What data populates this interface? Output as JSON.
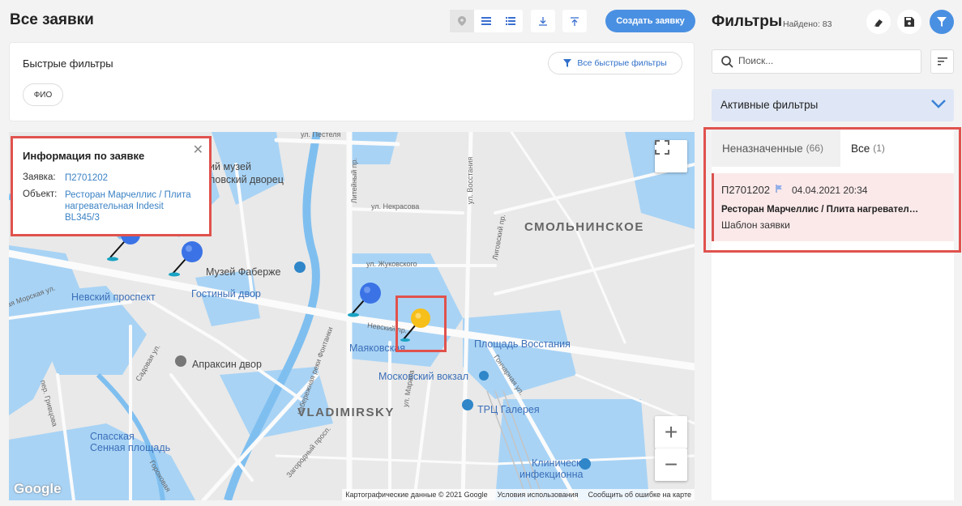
{
  "header": {
    "title": "Все заявки",
    "create_button": "Создать заявку"
  },
  "quick_filters": {
    "title": "Быстрые фильтры",
    "all_button": "Все быстрые фильтры",
    "chips": [
      "ФИО"
    ]
  },
  "map": {
    "info_window": {
      "title": "Информация по заявке",
      "request_label": "Заявка:",
      "request_value": "П2701202",
      "object_label": "Объект:",
      "object_value": "Ресторан Марчеллис / Плита нагревательная Indesit BL345/3"
    },
    "labels": {
      "museum_top": "ий музей",
      "palace": "ловский дворец",
      "faberge": "Музей Фаберже",
      "nevsky": "Невский проспект",
      "gostiny": "Гостиный двор",
      "nevsky_pr": "Невский пр.",
      "mayakovskaya": "Маяковская",
      "vosstaniya": "Площадь Восстания",
      "apraksin": "Апраксин двор",
      "moskovsky": "Московский вокзал",
      "smolninskoe": "СМОЛЬНИНСКОЕ",
      "vladimirsky": "VLADIMIRSKY",
      "galereya": "ТРЦ Галерея",
      "spasskaya": "Спасская",
      "sennaya": "Сенная площадь",
      "clinic1": "Клиническ",
      "clinic2": "инфекционна",
      "st_pestelya": "ул. Пестеля",
      "st_nekrasova": "ул. Некрасова",
      "st_zhukovskogo": "ул. Жуковского",
      "st_liteyny": "Литейный пр.",
      "st_voznesenskogo": "ул. Восстания",
      "st_ligovsky": "Лиговский пр.",
      "st_goncharnaya": "Гончарная ул.",
      "st_marata": "ул. Марата",
      "st_sadovaya": "Садовая ул.",
      "st_morskaya": "ьшая Морская ул.",
      "st_fontanka": "набережная реки Фонтанки",
      "st_zagorodny": "Загородный просп.",
      "st_griboedova": "пер. Гривцова",
      "st_gorokhovaya": "Гороховая"
    },
    "attribution": [
      "Картографические данные © 2021 Google",
      "Условия использования",
      "Сообщить об ошибке на карте"
    ],
    "google_logo": "Google",
    "zoom_in": "+",
    "zoom_out": "−"
  },
  "filters": {
    "title": "Фильтры",
    "found": "Найдено: 83",
    "search_placeholder": "Поиск...",
    "active_filters": "Активные фильтры"
  },
  "tabs": [
    {
      "label": "Неназначенные",
      "count": "(66)"
    },
    {
      "label": "Все",
      "count": "(1)"
    }
  ],
  "requests": [
    {
      "id": "П2701202",
      "date": "04.04.2021 20:34",
      "object": "Ресторан Марчеллис / Плита нагревательная Indesit BL345/3",
      "template": "Шаблон заявки"
    }
  ],
  "colors": {
    "accent": "#4a90e2",
    "highlight": "#e0524d",
    "card_bg": "#fbe9ea",
    "water": "#a8d3f5",
    "pin_blue": "#3b73e6",
    "pin_yellow": "#f6bf1a"
  }
}
